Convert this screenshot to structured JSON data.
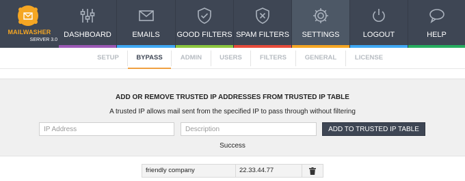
{
  "logo": {
    "brand": "MAILWASHER",
    "sub": "SERVER 3.0"
  },
  "nav": {
    "items": [
      {
        "label": "DASHBOARD",
        "icon": "sliders-icon",
        "color": "#9b59b6"
      },
      {
        "label": "EMAILS",
        "icon": "envelope-icon",
        "color": "#3fa9f5"
      },
      {
        "label": "GOOD FILTERS",
        "icon": "shield-check-icon",
        "color": "#8cc63f"
      },
      {
        "label": "SPAM FILTERS",
        "icon": "shield-x-icon",
        "color": "#e74c3c"
      },
      {
        "label": "SETTINGS",
        "icon": "gear-icon",
        "color": "#f5a623",
        "active": true
      },
      {
        "label": "LOGOUT",
        "icon": "power-icon",
        "color": "#3fa9f5"
      },
      {
        "label": "HELP",
        "icon": "chat-icon",
        "color": "#27ae60"
      }
    ]
  },
  "subtabs": {
    "items": [
      {
        "label": "SETUP"
      },
      {
        "label": "BYPASS",
        "active": true
      },
      {
        "label": "ADMIN"
      },
      {
        "label": "USERS"
      },
      {
        "label": "FILTERS"
      },
      {
        "label": "GENERAL"
      },
      {
        "label": "LICENSE"
      }
    ]
  },
  "panel": {
    "heading": "ADD OR REMOVE TRUSTED IP ADDRESSES FROM TRUSTED IP TABLE",
    "description": "A trusted IP allows mail sent from the specified IP to pass through without filtering",
    "ip_placeholder": "IP Address",
    "description_placeholder": "Description",
    "add_button": "ADD TO TRUSTED IP TABLE",
    "status": "Success"
  },
  "table": {
    "rows": [
      {
        "description": "friendly company",
        "ip": "22.33.44.77",
        "action_icon": "trash-icon"
      }
    ]
  },
  "colors": {
    "nav_bg": "#3e4654",
    "accent": "#f0a040",
    "panel_bg": "#f0f0f0"
  }
}
